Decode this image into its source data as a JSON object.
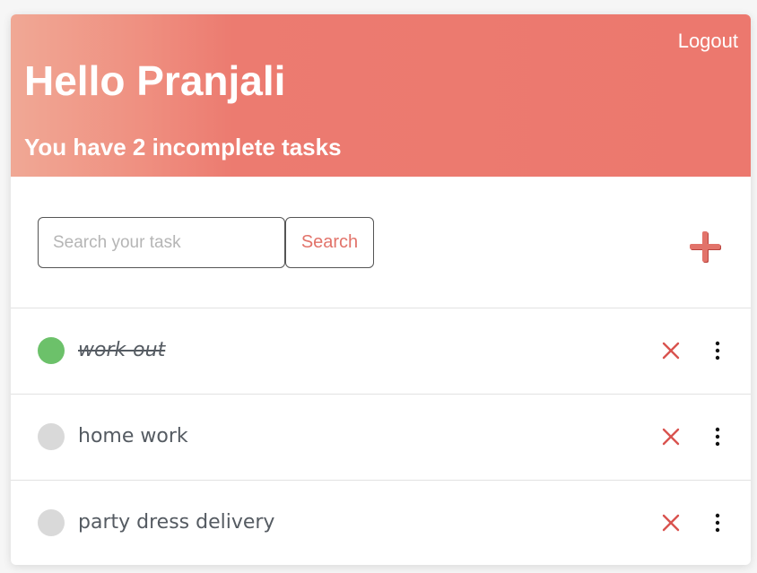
{
  "header": {
    "logout_label": "Logout",
    "greeting": "Hello Pranjali",
    "subtitle": "You have 2 incomplete tasks"
  },
  "search": {
    "placeholder": "Search your task",
    "value": "",
    "button_label": "Search"
  },
  "icons": {
    "add": "plus-icon",
    "delete": "close-icon",
    "more": "vertical-dots-icon"
  },
  "colors": {
    "accent": "#e2736a",
    "done": "#6cc16a",
    "pending": "#d9d9d9",
    "delete": "#d9534f"
  },
  "tasks": [
    {
      "label": "work-out",
      "completed": true
    },
    {
      "label": "home work",
      "completed": false
    },
    {
      "label": "party dress delivery",
      "completed": false
    }
  ]
}
